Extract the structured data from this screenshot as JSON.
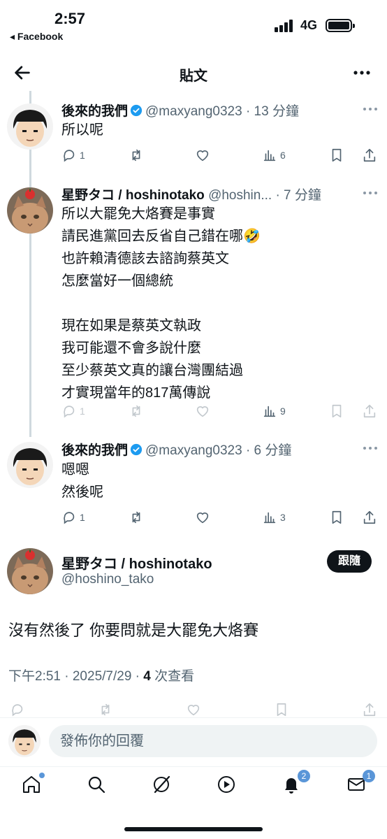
{
  "status_bar": {
    "time": "2:57",
    "back_app": "◂ Facebook",
    "network": "4G"
  },
  "header": {
    "title": "貼文"
  },
  "thread": [
    {
      "name": "後來的我們",
      "verified": true,
      "meta": "@maxyang0323 · 13 分鐘",
      "lines": [
        "所以呢"
      ],
      "replies": "1",
      "reposts": "",
      "likes": "",
      "views": "6",
      "avatar": "boy"
    },
    {
      "name": "星野タコ / hoshinotako",
      "verified": false,
      "meta": "@hoshin... · 7 分鐘",
      "lines": [
        "所以大罷免大烙賽是事實",
        "請民進黨回去反省自己錯在哪🤣",
        "也許賴清德該去諮詢蔡英文",
        "怎麼當好一個總統",
        "",
        "現在如果是蔡英文執政",
        "我可能還不會多說什麼",
        "至少蔡英文真的讓台灣團結過",
        "才實現當年的817萬傳說"
      ],
      "replies": "1",
      "reposts": "",
      "likes": "",
      "views": "9",
      "avatar": "cat"
    },
    {
      "name": "後來的我們",
      "verified": true,
      "meta": "@maxyang0323 · 6 分鐘",
      "lines": [
        "嗯嗯",
        "然後呢"
      ],
      "replies": "1",
      "reposts": "",
      "likes": "",
      "views": "3",
      "avatar": "boy"
    }
  ],
  "main_tweet": {
    "name": "星野タコ / hoshinotako",
    "handle": "@hoshino_tako",
    "follow_label": "跟隨",
    "text": "沒有然後了 你要問就是大罷免大烙賽",
    "timestamp": "下午2:51 · 2025/7/29 · ",
    "views_count": "4",
    "views_label": " 次查看"
  },
  "reply_box": {
    "placeholder": "發佈你的回覆"
  },
  "tabbar": {
    "notifications_badge": "2",
    "messages_badge": "1"
  },
  "colors": {
    "verified": "#1d9bf0",
    "text": "#0f1419",
    "muted": "#536471",
    "badge": "#5a96d8"
  }
}
